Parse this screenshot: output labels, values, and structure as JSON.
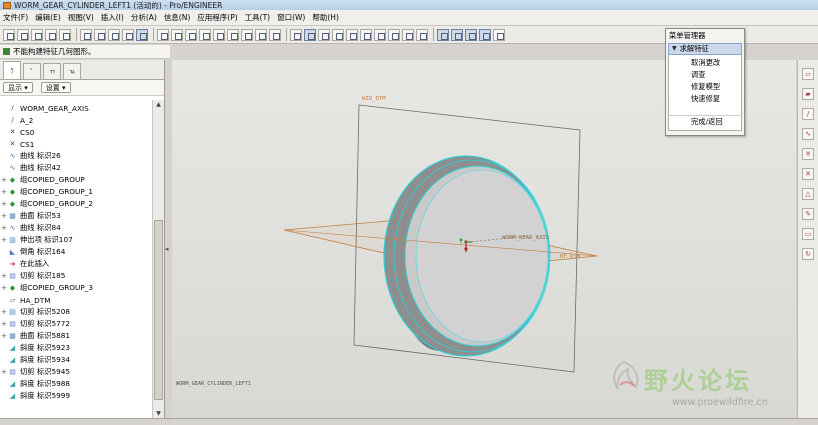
{
  "window": {
    "title": "WORM_GEAR_CYLINDER_LEFT1 (活动的) - Pro/ENGINEER"
  },
  "menubar": {
    "items": [
      "文件(F)",
      "编辑(E)",
      "视图(V)",
      "插入(I)",
      "分析(A)",
      "信息(N)",
      "应用程序(P)",
      "工具(T)",
      "窗口(W)",
      "帮助(H)"
    ]
  },
  "message": {
    "text": "不能构建特征几何图形。"
  },
  "panel": {
    "tabs": [
      "ﾗ",
      "ﾟ",
      "ﾢ",
      "ﾣ"
    ],
    "show_label": "显示 ▾",
    "settings_label": "设置 ▾"
  },
  "tree": {
    "items": [
      {
        "expander": "",
        "icon": "/",
        "label": "WORM_GEAR_AXIS",
        "color": "#555555"
      },
      {
        "expander": "",
        "icon": "/",
        "label": "A_2",
        "color": "#555555"
      },
      {
        "expander": "",
        "icon": "✕",
        "label": "CS0",
        "color": "#444444"
      },
      {
        "expander": "",
        "icon": "✕",
        "label": "CS1",
        "color": "#444444"
      },
      {
        "expander": "",
        "icon": "∿",
        "label": "曲线 标识26",
        "color": "#3b6fb0"
      },
      {
        "expander": "",
        "icon": "∿",
        "label": "曲线 标识42",
        "color": "#3b6fb0"
      },
      {
        "expander": "+",
        "icon": "◆",
        "label": "组COPIED_GROUP",
        "color": "#2f8f3f"
      },
      {
        "expander": "+",
        "icon": "◆",
        "label": "组COPIED_GROUP_1",
        "color": "#2f8f3f"
      },
      {
        "expander": "+",
        "icon": "◆",
        "label": "组COPIED_GROUP_2",
        "color": "#2f8f3f"
      },
      {
        "expander": "+",
        "icon": "▦",
        "label": "曲面 标识53",
        "color": "#4a7fc0"
      },
      {
        "expander": "+",
        "icon": "∿",
        "label": "曲线 标识84",
        "color": "#8a4ab0"
      },
      {
        "expander": "+",
        "icon": "▥",
        "label": "伸出项 标识107",
        "color": "#4a7fc0"
      },
      {
        "expander": "",
        "icon": "◣",
        "label": "倒角 标识164",
        "color": "#4a7fc0"
      },
      {
        "expander": "",
        "icon": "➜",
        "label": "在此插入",
        "color": "#c03030"
      },
      {
        "expander": "+",
        "icon": "▤",
        "label": "切剪 标识185",
        "color": "#4a7fc0"
      },
      {
        "expander": "+",
        "icon": "◆",
        "label": "组COPIED_GROUP_3",
        "color": "#2f8f3f"
      },
      {
        "expander": "",
        "icon": "▱",
        "label": "HA_DTM",
        "color": "#555555"
      },
      {
        "expander": "+",
        "icon": "▤",
        "label": "切剪 标识5208",
        "color": "#4a7fc0"
      },
      {
        "expander": "+",
        "icon": "▤",
        "label": "切剪 标识5772",
        "color": "#4a7fc0"
      },
      {
        "expander": "+",
        "icon": "▦",
        "label": "曲面 标识5881",
        "color": "#4a7fc0"
      },
      {
        "expander": "",
        "icon": "◢",
        "label": "斜度 标识5923",
        "color": "#3aa0b0"
      },
      {
        "expander": "",
        "icon": "◢",
        "label": "斜度 标识5934",
        "color": "#3aa0b0"
      },
      {
        "expander": "+",
        "icon": "▤",
        "label": "切剪 标识5945",
        "color": "#4a7fc0"
      },
      {
        "expander": "",
        "icon": "◢",
        "label": "斜度 标识5988",
        "color": "#3aa0b0"
      },
      {
        "expander": "",
        "icon": "◢",
        "label": "斜度 标识5999",
        "color": "#3aa0b0"
      }
    ]
  },
  "viewport": {
    "datum_top_label": "WID_DTM",
    "axis_label": "WORM_GEAR_AXIS",
    "datum_right_label": "HF_DTM",
    "csys_label": "WORM_GEAR_CYLINDER_LEFT1"
  },
  "menu_manager": {
    "title": "菜单管理器",
    "header": "求解特征",
    "items": [
      "取消更改",
      "调查",
      "修复模型",
      "快速修复"
    ],
    "done": "完成/返回"
  },
  "watermark": {
    "text": "野火论坛",
    "url": "www.proewildfire.cn"
  },
  "colors": {
    "accent": "#cdd9ea",
    "model_edge": "#2ad0d8",
    "datum": "#c08040"
  }
}
